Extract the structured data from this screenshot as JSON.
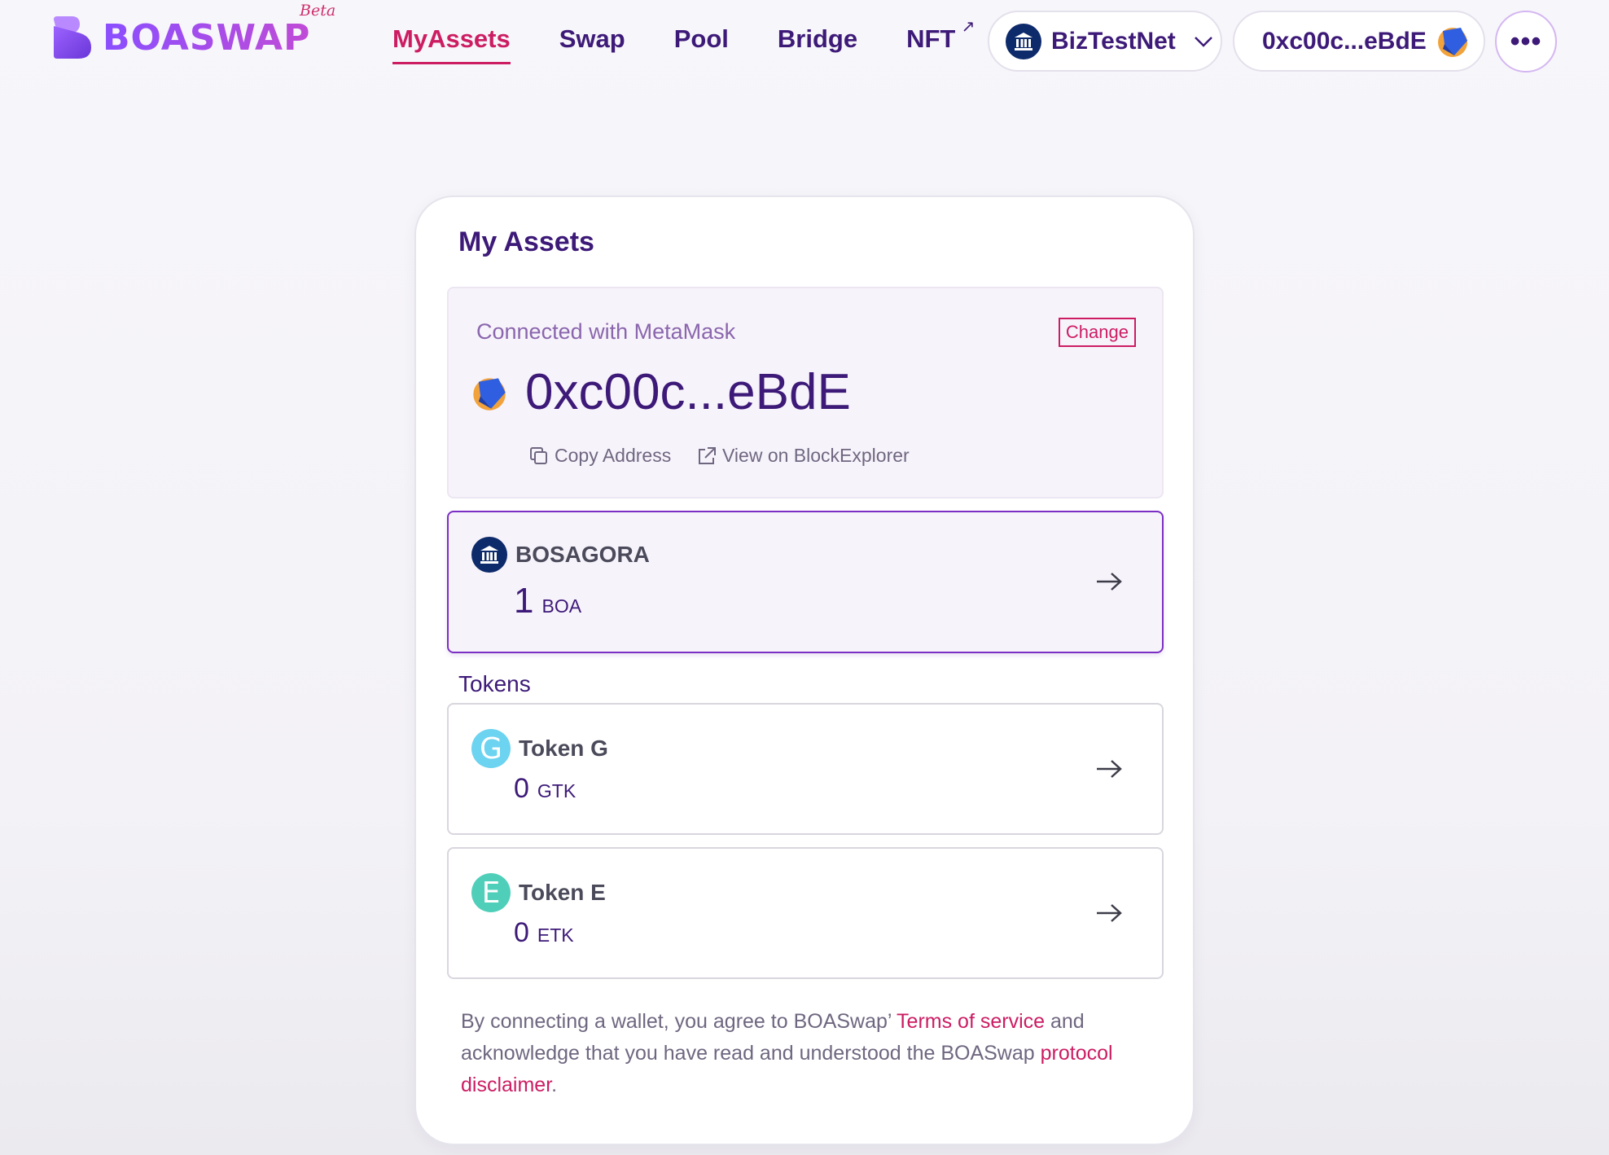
{
  "brand": {
    "name": "BOASWAP",
    "badge": "Beta"
  },
  "nav": {
    "items": [
      {
        "label": "MyAssets",
        "active": true
      },
      {
        "label": "Swap"
      },
      {
        "label": "Pool"
      },
      {
        "label": "Bridge"
      },
      {
        "label": "NFT",
        "external": true
      }
    ]
  },
  "header": {
    "network": "BizTestNet",
    "account": "0xc00c...eBdE",
    "more_icon": "more-horizontal-icon"
  },
  "card": {
    "title": "My Assets",
    "wallet": {
      "connected_text": "Connected with MetaMask",
      "change_label": "Change",
      "address": "0xc00c...eBdE",
      "copy_label": "Copy Address",
      "explorer_label": "View on BlockExplorer"
    },
    "native_asset": {
      "name": "BOSAGORA",
      "amount": "1",
      "symbol": "BOA"
    },
    "tokens_label": "Tokens",
    "tokens": [
      {
        "letter": "G",
        "name": "Token G",
        "amount": "0",
        "symbol": "GTK",
        "color": "#6cd3f0"
      },
      {
        "letter": "E",
        "name": "Token E",
        "amount": "0",
        "symbol": "ETK",
        "color": "#4fcfb9"
      }
    ],
    "disclaimer": {
      "part1": "By connecting a wallet, you agree to BOASwap’ ",
      "terms": "Terms of service",
      "part2": " and acknowledge that you have read and understood the BOASwap ",
      "protocol": "protocol disclaimer",
      "end": "."
    }
  },
  "colors": {
    "accent": "#cc1d63",
    "primary": "#3d1a78",
    "selected_border": "#7b2fc4"
  }
}
